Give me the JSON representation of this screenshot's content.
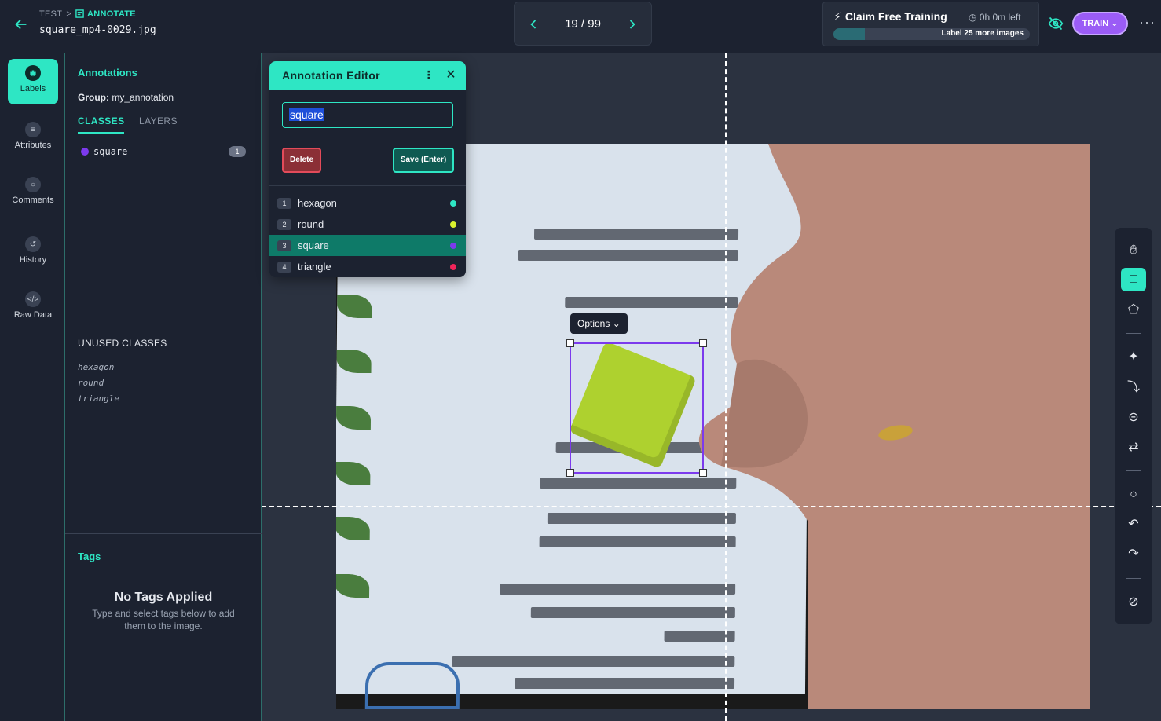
{
  "header": {
    "breadcrumb_project": "TEST",
    "breadcrumb_section": "ANNOTATE",
    "filename": "square_mp4-0029.jpg",
    "pager": "19 / 99",
    "claim_title": "Claim Free Training",
    "time_left": "0h 0m left",
    "progress_label": "Label 25 more images",
    "progress_fraction": 0.16,
    "train_label": "TRAIN"
  },
  "rail": {
    "items": [
      {
        "label": "Labels",
        "icon": "label-icon"
      },
      {
        "label": "Attributes",
        "icon": "list-icon"
      },
      {
        "label": "Comments",
        "icon": "comment-icon"
      },
      {
        "label": "History",
        "icon": "history-icon"
      },
      {
        "label": "Raw Data",
        "icon": "code-icon"
      }
    ]
  },
  "panel": {
    "title": "Annotations",
    "group_label": "Group:",
    "group_value": "my_annotation",
    "tab_classes": "CLASSES",
    "tab_layers": "LAYERS",
    "classes": [
      {
        "name": "square",
        "count": "1",
        "color": "#7c3aed"
      }
    ],
    "unused_title": "UNUSED CLASSES",
    "unused": [
      "hexagon",
      "round",
      "triangle"
    ],
    "tags_title": "Tags",
    "no_tags_title": "No Tags Applied",
    "no_tags_sub": "Type and select tags below to add them to the image."
  },
  "canvas": {
    "options_label": "Options"
  },
  "editor": {
    "title": "Annotation Editor",
    "input_value": "square",
    "delete_label": "Delete",
    "save_label": "Save (Enter)",
    "options": [
      {
        "num": "1",
        "label": "hexagon",
        "color": "#2ee6c4"
      },
      {
        "num": "2",
        "label": "round",
        "color": "#d9f02e"
      },
      {
        "num": "3",
        "label": "square",
        "color": "#7c3aed"
      },
      {
        "num": "4",
        "label": "triangle",
        "color": "#f0245a"
      }
    ]
  },
  "toolbar": {
    "tools": [
      "hand-icon",
      "bbox-icon",
      "polygon-icon",
      "smart-select-icon",
      "magic-wand-icon",
      "keypoint-icon",
      "repeat-icon",
      "comment-icon",
      "undo-icon",
      "redo-icon",
      "null-icon"
    ]
  }
}
